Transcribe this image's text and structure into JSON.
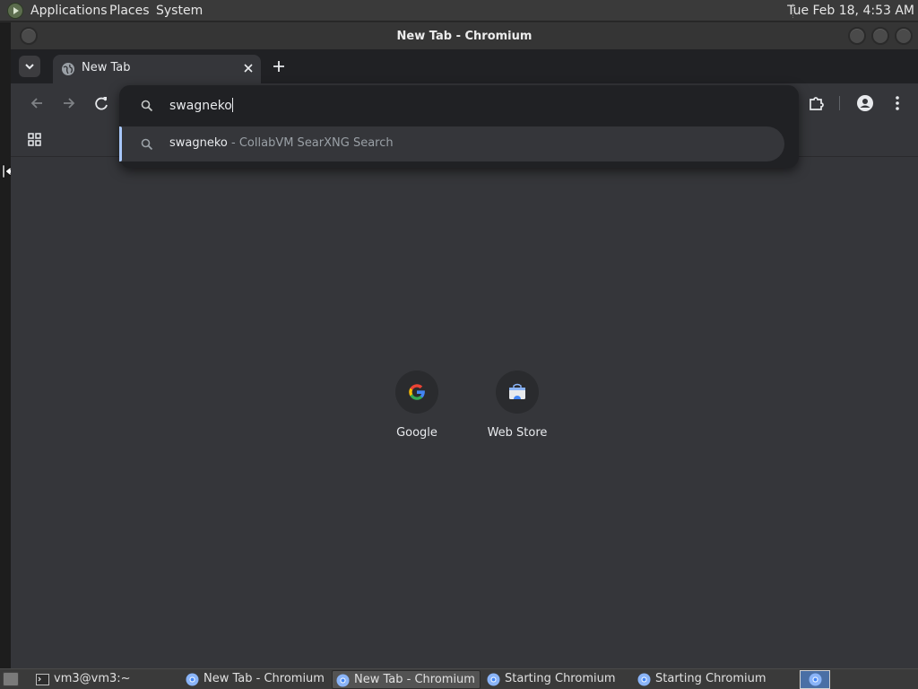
{
  "top_panel": {
    "menus": [
      "Applications",
      "Places",
      "System"
    ],
    "clock": "Tue Feb 18,  4:53 AM"
  },
  "window": {
    "title": "New Tab - Chromium"
  },
  "browser": {
    "tab": {
      "title": "New Tab"
    },
    "omnibox": {
      "value": "swagneko",
      "suggestion": {
        "query": "swagneko",
        "description": " - CollabVM SearXNG Search"
      }
    }
  },
  "new_tab_page": {
    "shortcuts": [
      {
        "label": "Google"
      },
      {
        "label": "Web Store"
      }
    ]
  },
  "taskbar": {
    "items": [
      {
        "label": "vm3@vm3:~",
        "icon": "terminal-icon"
      },
      {
        "label": "New Tab - Chromium",
        "icon": "chromium-icon"
      },
      {
        "label": "New Tab - Chromium",
        "icon": "chromium-icon"
      },
      {
        "label": "Starting Chromium",
        "icon": "chromium-icon"
      },
      {
        "label": "Starting Chromium",
        "icon": "chromium-icon"
      }
    ]
  },
  "colors": {
    "accent": "#a8c7fa",
    "toolbar": "#35363a",
    "omnibox_bg": "#202124"
  }
}
